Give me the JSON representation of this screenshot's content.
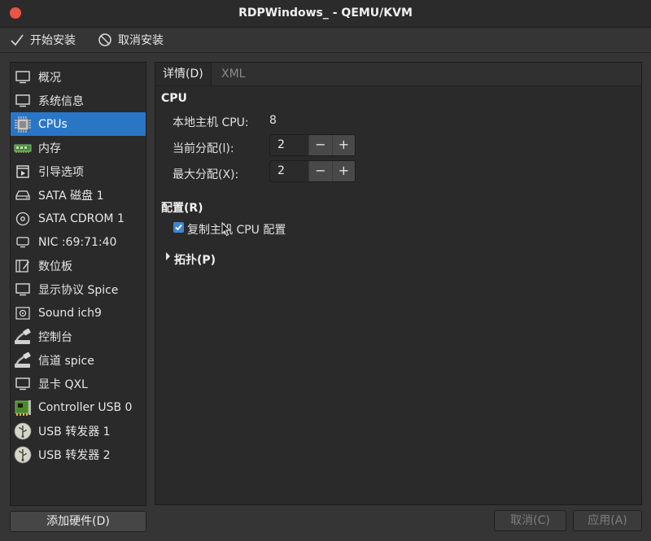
{
  "window": {
    "title": "RDPWindows_ - QEMU/KVM"
  },
  "toolbar": {
    "begin_install": "开始安装",
    "cancel_install": "取消安装"
  },
  "sidebar": {
    "items": [
      {
        "label": "概况",
        "icon": "monitor-icon"
      },
      {
        "label": "系统信息",
        "icon": "info-monitor-icon"
      },
      {
        "label": "CPUs",
        "icon": "cpu-chip-icon",
        "selected": true
      },
      {
        "label": "内存",
        "icon": "memory-ram-icon"
      },
      {
        "label": "引导选项",
        "icon": "boot-options-icon"
      },
      {
        "label": "SATA 磁盘 1",
        "icon": "disk-drive-icon"
      },
      {
        "label": "SATA CDROM 1",
        "icon": "cdrom-icon"
      },
      {
        "label": "NIC :69:71:40",
        "icon": "network-nic-icon"
      },
      {
        "label": "数位板",
        "icon": "tablet-icon"
      },
      {
        "label": "显示协议 Spice",
        "icon": "display-icon"
      },
      {
        "label": "Sound ich9",
        "icon": "sound-icon"
      },
      {
        "label": "控制台",
        "icon": "serial-console-icon"
      },
      {
        "label": "信道 spice",
        "icon": "channel-icon"
      },
      {
        "label": "显卡 QXL",
        "icon": "video-card-icon"
      },
      {
        "label": "Controller USB 0",
        "icon": "usb-controller-icon"
      },
      {
        "label": "USB 转发器 1",
        "icon": "usb-redirector-icon"
      },
      {
        "label": "USB 转发器 2",
        "icon": "usb-redirector-icon"
      }
    ]
  },
  "tabs": {
    "details": "详情(D)",
    "xml": "XML"
  },
  "cpu": {
    "section_title": "CPU",
    "host_cpu_label": "本地主机 CPU:",
    "host_cpu_value": "8",
    "current_alloc_label": "当前分配(l):",
    "current_alloc_value": "2",
    "max_alloc_label": "最大分配(X):",
    "max_alloc_value": "2",
    "minus": "−",
    "plus": "+"
  },
  "config": {
    "section_title": "配置(R)",
    "copy_host_cpu_label": "复制主机 CPU 配置",
    "copy_host_cpu_checked": true
  },
  "topology": {
    "label": "拓扑(P)"
  },
  "buttons": {
    "add_hardware": "添加硬件(D)",
    "cancel": "取消(C)",
    "apply": "应用(A)"
  },
  "colors": {
    "selection": "#2a76c6",
    "close_button": "#e95445",
    "checkbox": "#3a86d6"
  }
}
